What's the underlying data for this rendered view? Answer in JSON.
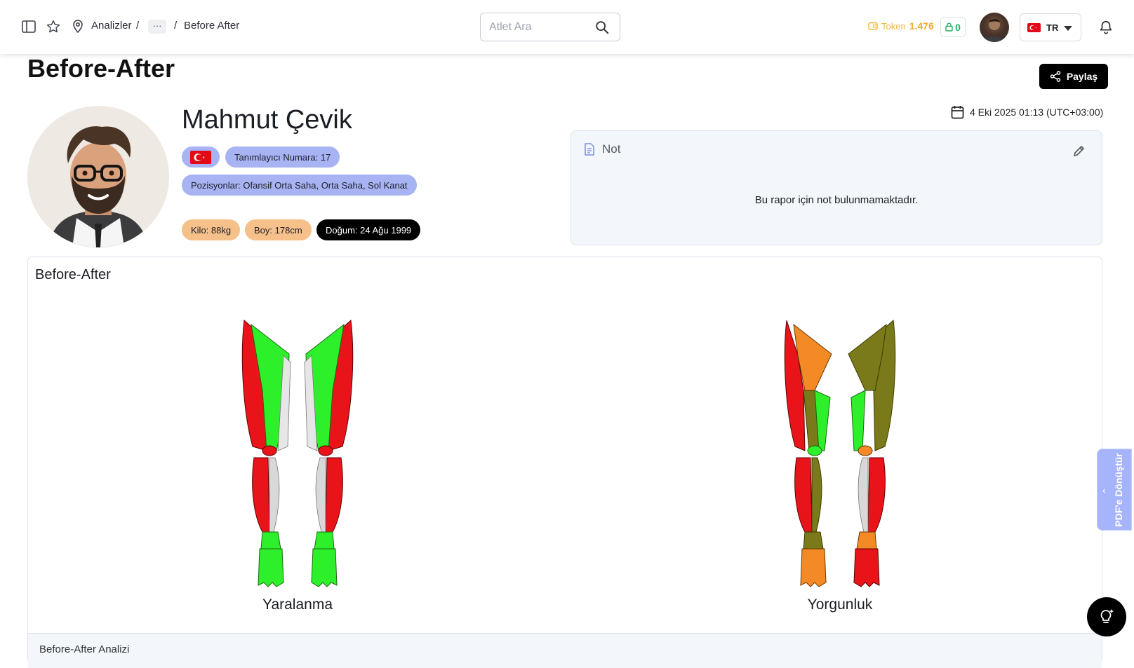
{
  "topbar": {
    "breadcrumb": [
      "Analizler",
      "/",
      "···",
      "/",
      "Before After"
    ],
    "search_placeholder": "Atlet Ara",
    "token_label": "Token",
    "token_value": "1.476",
    "locked_value": "0",
    "language": "TR"
  },
  "page": {
    "title": "Before-After",
    "share_label": "Paylaş"
  },
  "athlete": {
    "name": "Mahmut Çevik",
    "identifier": "Tanımlayıcı Numara: 17",
    "positions": "Pozisyonlar: Ofansif Orta Saha, Orta Saha, Sol Kanat",
    "weight": "Kilo: 88kg",
    "height": "Boy: 178cm",
    "birth": "Doğum: 24 Ağu 1999"
  },
  "report": {
    "date": "4 Eki 2025 01:13 (UTC+03:00)"
  },
  "note": {
    "title": "Not",
    "empty_text": "Bu rapor için not bulunmamaktadır."
  },
  "before_after": {
    "title": "Before-After",
    "figures": [
      {
        "caption": "Yaralanma"
      },
      {
        "caption": "Yorgunluk"
      }
    ],
    "sub_label": "Before-After Analizi"
  },
  "side_tab": {
    "label": "PDF'e Dönüştür"
  },
  "colors": {
    "accent_blue": "#a7b3f3",
    "injury_red": "#e8141a",
    "ok_green": "#2ef02a",
    "fatigue_olive": "#7a7a1a",
    "fatigue_orange": "#f38a26",
    "token_yellow": "#f0a92c"
  }
}
